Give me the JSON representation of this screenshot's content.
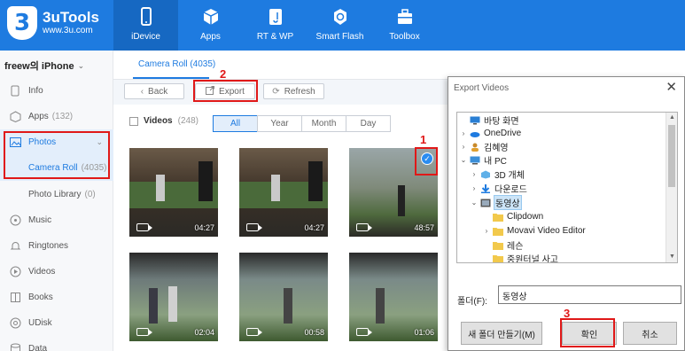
{
  "app": {
    "name": "3uTools",
    "url": "www.3u.com",
    "logo_glyph": "3"
  },
  "nav": [
    {
      "label": "iDevice",
      "icon": "phone-icon",
      "active": true
    },
    {
      "label": "Apps",
      "icon": "cube-icon"
    },
    {
      "label": "RT & WP",
      "icon": "music-icon"
    },
    {
      "label": "Smart Flash",
      "icon": "refresh-icon"
    },
    {
      "label": "Toolbox",
      "icon": "toolbox-icon"
    }
  ],
  "sidebar": {
    "device": "freew의 iPhone",
    "device_chevron": "⌄",
    "items": [
      {
        "label": "Info",
        "count": ""
      },
      {
        "label": "Apps",
        "count": "(132)"
      },
      {
        "label": "Photos",
        "count": ""
      },
      {
        "label": "Camera Roll",
        "count": "(4035)"
      },
      {
        "label": "Photo Library",
        "count": "(0)"
      },
      {
        "label": "Music",
        "count": ""
      },
      {
        "label": "Ringtones",
        "count": ""
      },
      {
        "label": "Videos",
        "count": ""
      },
      {
        "label": "Books",
        "count": ""
      },
      {
        "label": "UDisk",
        "count": ""
      },
      {
        "label": "Data",
        "count": ""
      }
    ]
  },
  "main": {
    "tab": "Camera Roll (4035)",
    "toolbar": {
      "back": "Back",
      "export": "Export",
      "refresh": "Refresh"
    },
    "filter": {
      "label": "Videos",
      "count": "(248)",
      "segments": [
        "All",
        "Year",
        "Month",
        "Day"
      ],
      "active_segment": "All"
    },
    "thumbs": [
      {
        "duration": "04:27"
      },
      {
        "duration": "04:27"
      },
      {
        "duration": "48:57",
        "checked": true
      },
      {
        "duration": "02:04"
      },
      {
        "duration": "00:58"
      },
      {
        "duration": "01:06"
      }
    ]
  },
  "dialog": {
    "title": "Export Videos",
    "close": "✕",
    "tree": [
      {
        "label": "바탕 화면",
        "expander": "",
        "icon": "desktop-icon"
      },
      {
        "label": "OneDrive",
        "expander": "›",
        "icon": "cloud-icon"
      },
      {
        "label": "김혜영",
        "expander": "›",
        "icon": "user-icon"
      },
      {
        "label": "내 PC",
        "expander": "⌄",
        "icon": "pc-icon"
      },
      {
        "label": "3D 개체",
        "expander": "›",
        "icon": "cube-folder-icon"
      },
      {
        "label": "다운로드",
        "expander": "›",
        "icon": "download-icon"
      },
      {
        "label": "동영상",
        "expander": "⌄",
        "icon": "video-folder-icon",
        "selected": true
      },
      {
        "label": "Clipdown",
        "expander": "",
        "icon": "folder-icon"
      },
      {
        "label": "Movavi Video Editor",
        "expander": "›",
        "icon": "folder-icon"
      },
      {
        "label": "레슨",
        "expander": "",
        "icon": "folder-icon"
      },
      {
        "label": "중원터널 사고",
        "expander": "",
        "icon": "folder-icon"
      }
    ],
    "folder_label": "폴더(F):",
    "folder_value": "동영상",
    "new_folder": "새 폴더 만들기(M)",
    "ok": "확인",
    "cancel": "취소"
  },
  "annotations": {
    "one": "1",
    "two": "2",
    "three": "3"
  },
  "colors": {
    "brand": "#1e7be0",
    "annotation": "#e01818"
  }
}
